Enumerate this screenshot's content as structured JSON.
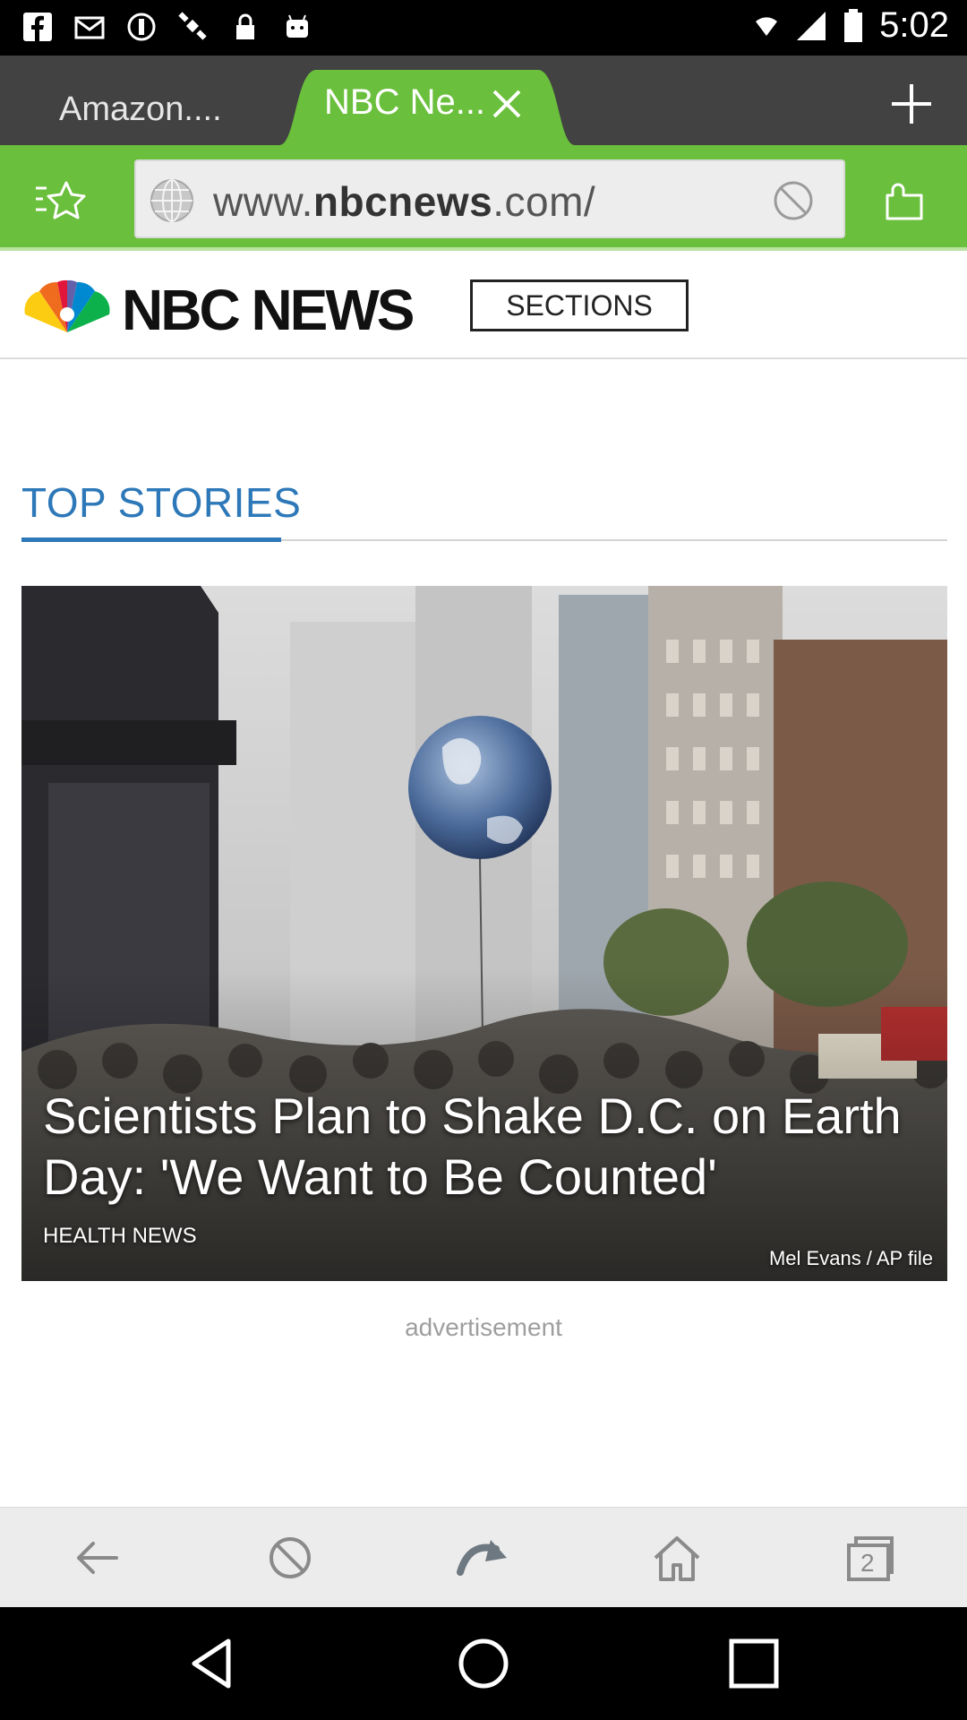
{
  "status_bar": {
    "time": "5:02"
  },
  "tabs": [
    {
      "label": "Amazon....",
      "active": false
    },
    {
      "label": "NBC Ne...",
      "active": true
    }
  ],
  "toolbar": {
    "url_prefix": "www.",
    "url_domain": "nbcnews",
    "url_suffix": ".com/"
  },
  "site_header": {
    "logo_text": "NBC NEWS",
    "sections_label": "SECTIONS"
  },
  "top_stories": {
    "heading": "TOP STORIES"
  },
  "hero": {
    "title": "Scientists Plan to Shake D.C. on Earth Day: 'We Want to Be Counted'",
    "section": "HEALTH NEWS",
    "credit": "Mel Evans / AP file"
  },
  "advertisement_label": "advertisement",
  "bottom_nav": {
    "tab_count": "2",
    "items": [
      "back-icon",
      "stop-icon",
      "refresh-icon",
      "home-icon",
      "tabs-icon"
    ]
  },
  "colors": {
    "toolbar_green": "#6abf3c",
    "tab_bar": "#424242",
    "link_blue": "#2d78b8"
  }
}
